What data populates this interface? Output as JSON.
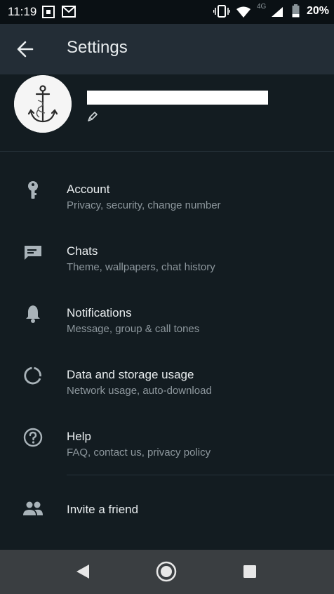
{
  "status_bar": {
    "time": "11:19",
    "network": "4G",
    "battery": "20%"
  },
  "app_bar": {
    "title": "Settings"
  },
  "profile": {
    "name_redacted": true
  },
  "menu": [
    {
      "id": "account",
      "icon": "key-icon",
      "title": "Account",
      "subtitle": "Privacy, security, change number"
    },
    {
      "id": "chats",
      "icon": "chat-icon",
      "title": "Chats",
      "subtitle": "Theme, wallpapers, chat history"
    },
    {
      "id": "notifications",
      "icon": "bell-icon",
      "title": "Notifications",
      "subtitle": "Message, group & call tones"
    },
    {
      "id": "data-storage",
      "icon": "data-usage-icon",
      "title": "Data and storage usage",
      "subtitle": "Network usage, auto-download"
    },
    {
      "id": "help",
      "icon": "help-icon",
      "title": "Help",
      "subtitle": "FAQ, contact us, privacy policy"
    }
  ],
  "invite": {
    "icon": "people-icon",
    "title": "Invite a friend"
  },
  "colors": {
    "background": "#131c21",
    "app_bar": "#232d36",
    "primary_text": "#e9edef",
    "secondary_text": "#8d979d",
    "icon": "#a9b3b9",
    "nav_bar": "#3a3e41"
  }
}
